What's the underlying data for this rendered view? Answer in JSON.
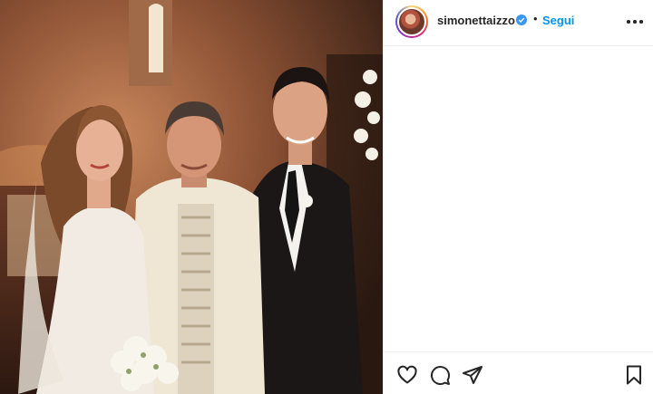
{
  "post": {
    "photo_alt": "Wedding photo of a bride, a priest and a groom in a church",
    "header": {
      "username": "simonettaizzo",
      "verified": true,
      "separator": "•",
      "follow_label": "Segui",
      "avatar_icon": "profile-avatar"
    },
    "actions": {
      "like_icon": "heart-icon",
      "comment_icon": "comment-icon",
      "share_icon": "paper-plane-icon",
      "save_icon": "bookmark-icon"
    },
    "colors": {
      "follow_blue": "#0095f6",
      "verified_blue": "#3897f0",
      "text": "#262626",
      "divider": "#efefef"
    }
  }
}
